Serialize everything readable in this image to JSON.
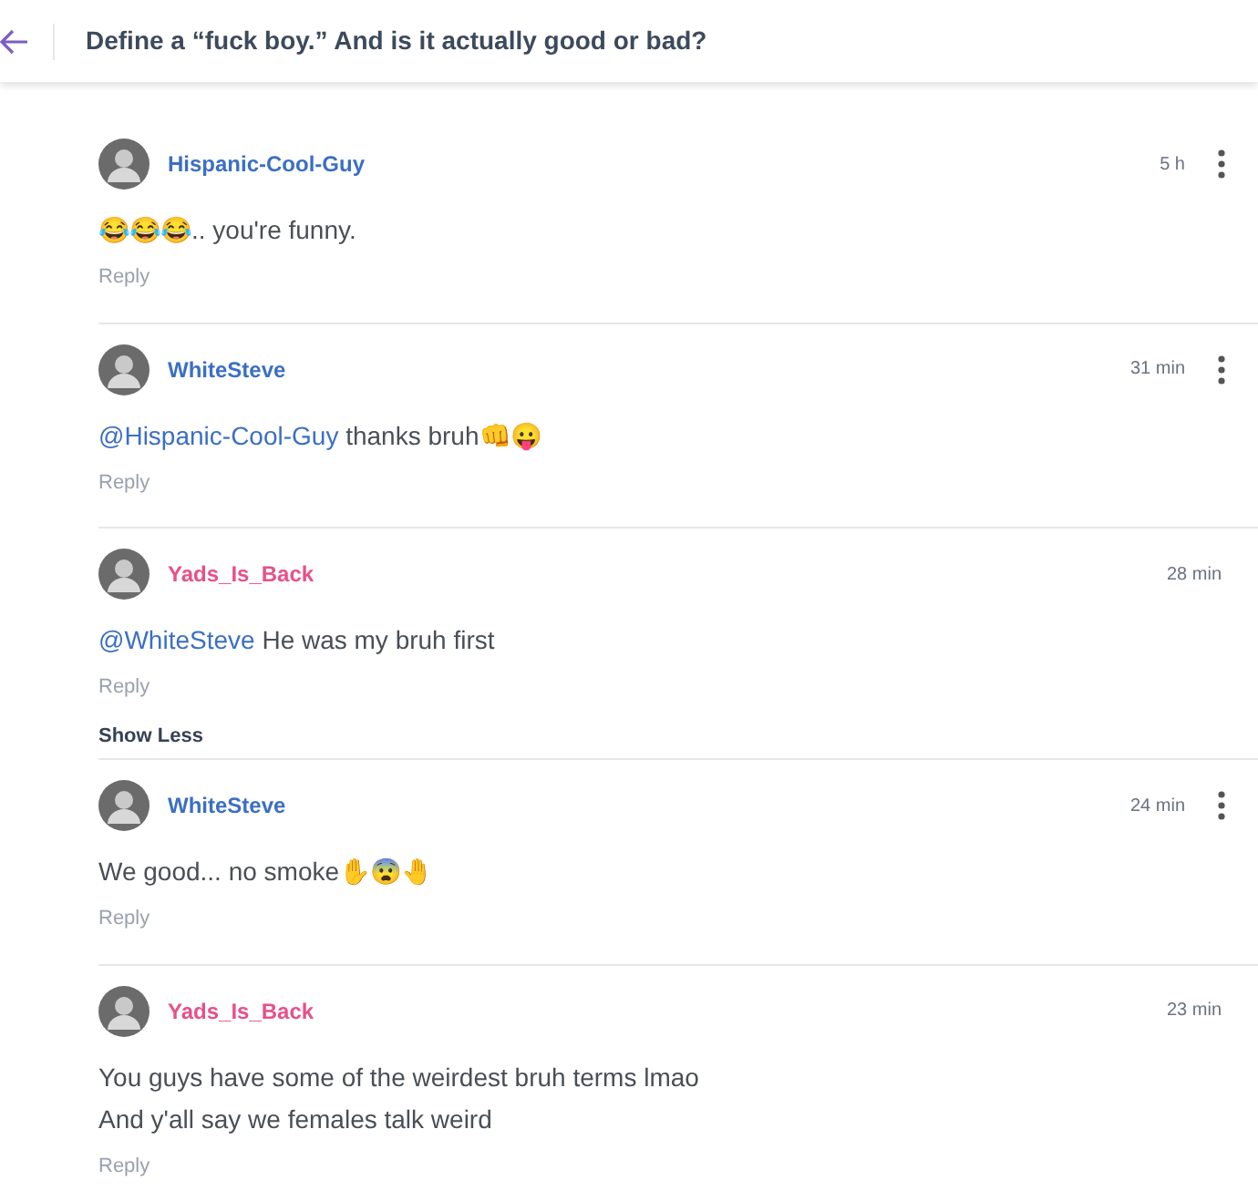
{
  "header": {
    "title": "Define a “fuck boy.” And is it actually good or bad?"
  },
  "comments": [
    {
      "author": "Hispanic-Cool-Guy",
      "color": "#3b6fc4",
      "time": "5 h",
      "has_menu": true,
      "body": [
        {
          "kind": "text",
          "text": "😂😂😂.. you're funny."
        }
      ],
      "reply": "Reply"
    },
    {
      "author": "WhiteSteve",
      "color": "#3b6fc4",
      "time": "31 min",
      "has_menu": true,
      "body": [
        {
          "kind": "mention",
          "text": "@Hispanic-Cool-Guy"
        },
        {
          "kind": "text",
          "text": " thanks bruh👊😛"
        }
      ],
      "reply": "Reply"
    },
    {
      "author": "Yads_Is_Back",
      "color": "#e8508a",
      "time": "28 min",
      "has_menu": false,
      "body": [
        {
          "kind": "mention",
          "text": "@WhiteSteve"
        },
        {
          "kind": "text",
          "text": " He was my bruh first"
        }
      ],
      "reply": "Reply",
      "show_less": "Show Less"
    },
    {
      "author": "WhiteSteve",
      "color": "#3b6fc4",
      "time": "24 min",
      "has_menu": true,
      "body": [
        {
          "kind": "text",
          "text": "We good... no smoke✋😨🤚"
        }
      ],
      "reply": "Reply"
    },
    {
      "author": "Yads_Is_Back",
      "color": "#e8508a",
      "time": "23 min",
      "has_menu": false,
      "body": [
        {
          "kind": "text",
          "text": "You guys have some of the weirdest bruh terms lmao"
        },
        {
          "kind": "break"
        },
        {
          "kind": "text",
          "text": "And y'all say we females talk weird"
        }
      ],
      "reply": "Reply"
    }
  ]
}
